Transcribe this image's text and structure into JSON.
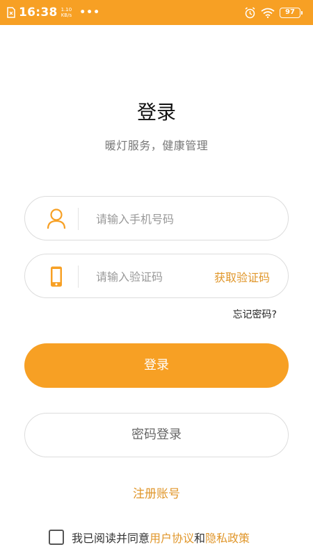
{
  "status_bar": {
    "time": "16:38",
    "net_speed_value": "1.10",
    "net_speed_unit": "KB/s",
    "more": "•••",
    "battery": "97"
  },
  "login": {
    "title": "登录",
    "subtitle": "暖灯服务，健康管理",
    "phone_placeholder": "请输入手机号码",
    "code_placeholder": "请输入验证码",
    "get_code": "获取验证码",
    "forgot_password": "忘记密码?",
    "login_button": "登录",
    "password_login_button": "密码登录",
    "register": "注册账号"
  },
  "agreement": {
    "prefix": "我已阅读并同意",
    "user_agreement": "用户协议",
    "and": "和",
    "privacy_policy": "隐私政策"
  },
  "colors": {
    "accent": "#F7A024",
    "link": "#E0962A",
    "border": "#dcdcdc"
  },
  "icons": [
    "sim-icon",
    "alarm-icon",
    "wifi-icon",
    "battery-icon",
    "user-icon",
    "phone-icon"
  ]
}
